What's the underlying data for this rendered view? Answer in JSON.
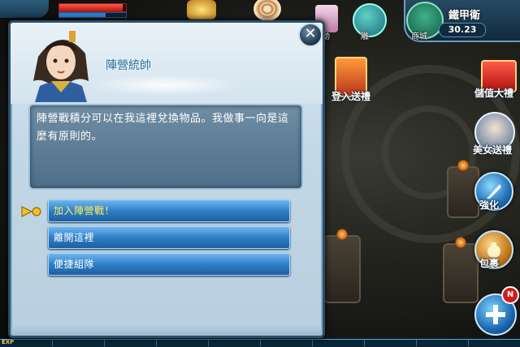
{
  "hud": {
    "hp_fraction": 0.95,
    "mp_fraction": 0.7,
    "top_icons": [
      {
        "icon": "gold-pile-icon",
        "label": ""
      },
      {
        "icon": "target-icon",
        "label": ""
      },
      {
        "icon": "scroll-icon",
        "label": "動"
      },
      {
        "icon": "statue-icon",
        "label": "雕"
      },
      {
        "icon": "pagoda-shop-icon",
        "label": "商城"
      }
    ],
    "server_name": "鐵甲衛",
    "currency_value": "30.23"
  },
  "side_buttons": {
    "login_gift": "登入送禮",
    "topup_gift": "儲值大禮",
    "portrait_label": "美女送禮",
    "enhance": "強化",
    "bag": "包裹",
    "plus_badge": "N"
  },
  "dialog": {
    "npc_name": "陣營統帥",
    "text": "陣營戰積分可以在我這裡兌換物品。我做事一向是這麼有原則的。",
    "options": [
      {
        "label": "加入陣營戰！",
        "active": true
      },
      {
        "label": "離開這裡",
        "active": false
      },
      {
        "label": "便捷組隊",
        "active": false
      }
    ],
    "close_symbol": "✕"
  },
  "xp": {
    "label": "EXP"
  },
  "colors": {
    "option_text": "#ffffff",
    "option_active_text": "#ffef5a",
    "npc_name": "#2a6f9e",
    "dialog_bg": "#c3d8e6"
  }
}
